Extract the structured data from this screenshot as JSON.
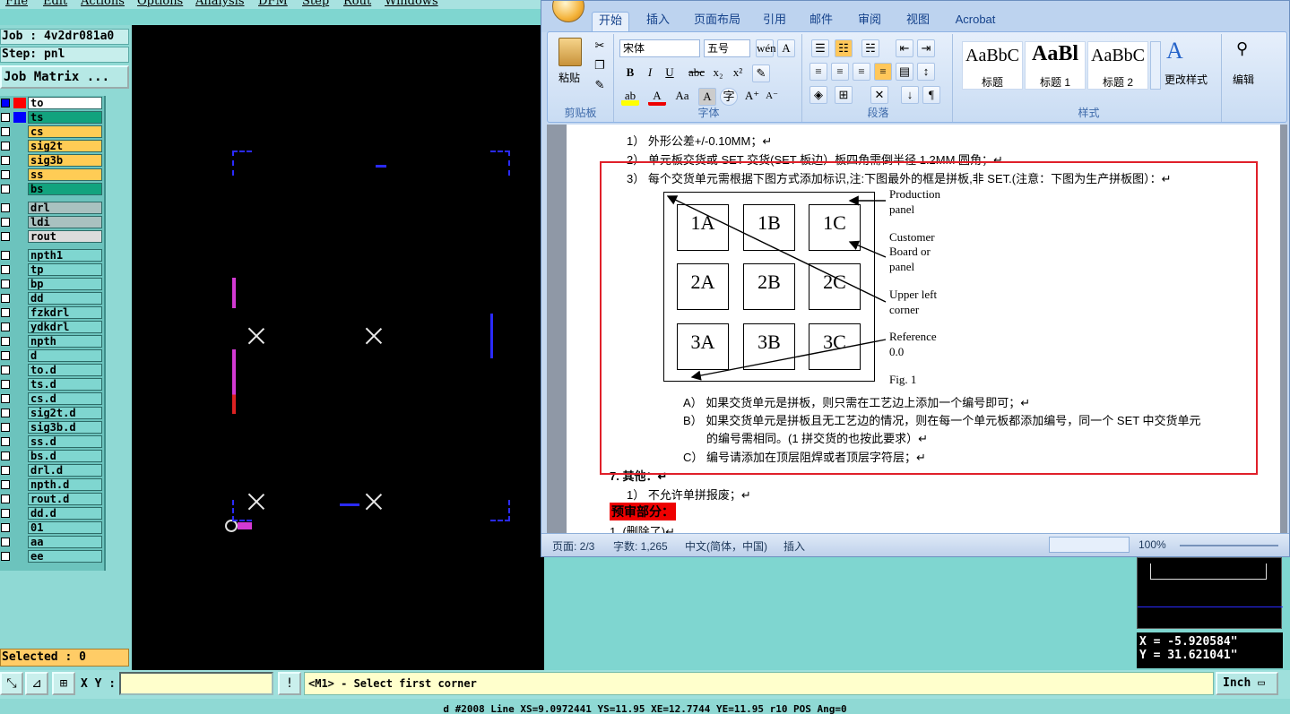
{
  "menu": [
    "File",
    "Edit",
    "Actions",
    "Options",
    "Analysis",
    "DFM",
    "Step",
    "Rout",
    "Windows"
  ],
  "job": {
    "label": "Job : 4v2dr081a0",
    "step": "Step: pnl",
    "matrix_button": "Job Matrix ..."
  },
  "layers": [
    {
      "name": "to",
      "color": "#ffffff",
      "sw": "#ff0000",
      "sel": "#0000ff"
    },
    {
      "name": "ts",
      "color": "#12a37e",
      "sw": "#0000ff"
    },
    {
      "name": "cs",
      "color": "#ffcc55"
    },
    {
      "name": "sig2t",
      "color": "#ffcc55"
    },
    {
      "name": "sig3b",
      "color": "#ffcc55"
    },
    {
      "name": "ss",
      "color": "#ffcc55"
    },
    {
      "name": "bs",
      "color": "#12a37e"
    },
    {
      "name": "drl",
      "color": "#a9c1c0"
    },
    {
      "name": "ldi",
      "color": "#a9c1c0"
    },
    {
      "name": "rout",
      "color": "#dcdcdc"
    },
    {
      "name": "npth1",
      "color": "#7fd6d0"
    },
    {
      "name": "tp",
      "color": "#7fd6d0"
    },
    {
      "name": "bp",
      "color": "#7fd6d0"
    },
    {
      "name": "dd",
      "color": "#7fd6d0"
    },
    {
      "name": "fzkdrl",
      "color": "#7fd6d0"
    },
    {
      "name": "ydkdrl",
      "color": "#7fd6d0"
    },
    {
      "name": "npth",
      "color": "#7fd6d0"
    },
    {
      "name": "d",
      "color": "#7fd6d0"
    },
    {
      "name": "to.d",
      "color": "#7fd6d0"
    },
    {
      "name": "ts.d",
      "color": "#7fd6d0"
    },
    {
      "name": "cs.d",
      "color": "#7fd6d0"
    },
    {
      "name": "sig2t.d",
      "color": "#7fd6d0"
    },
    {
      "name": "sig3b.d",
      "color": "#7fd6d0"
    },
    {
      "name": "ss.d",
      "color": "#7fd6d0"
    },
    {
      "name": "bs.d",
      "color": "#7fd6d0"
    },
    {
      "name": "drl.d",
      "color": "#7fd6d0"
    },
    {
      "name": "npth.d",
      "color": "#7fd6d0"
    },
    {
      "name": "rout.d",
      "color": "#7fd6d0"
    },
    {
      "name": "dd.d",
      "color": "#7fd6d0"
    },
    {
      "name": "01",
      "color": "#7fd6d0"
    },
    {
      "name": "aa",
      "color": "#7fd6d0"
    },
    {
      "name": "ee",
      "color": "#7fd6d0"
    }
  ],
  "selected": "Selected : 0",
  "word": {
    "tabs": [
      "开始",
      "插入",
      "页面布局",
      "引用",
      "邮件",
      "审阅",
      "视图",
      "Acrobat"
    ],
    "clipboard": {
      "paste": "粘贴",
      "group": "剪贴板"
    },
    "font": {
      "name": "宋体",
      "size": "五号",
      "group": "字体"
    },
    "paragraph": {
      "group": "段落"
    },
    "styles": {
      "items": [
        {
          "sample": "AaBbC",
          "name": "标题"
        },
        {
          "sample": "AaBl",
          "name": "标题 1"
        },
        {
          "sample": "AaBbC",
          "name": "标题 2"
        }
      ],
      "change": "更改样式",
      "group": "样式"
    },
    "edit": "编辑",
    "doc": {
      "l1": "1） 外形公差+/-0.10MM；↵",
      "l2": "2） 单元板交货或 SET 交货(SET 板边）板四角需倒半径 1.2MM 圆角；↵",
      "l3": "3） 每个交货单元需根据下图方式添加标识,注:下图最外的框是拼板,非 SET.(注意：下图为生产拼板图）：↵",
      "cells": [
        "1A",
        "1B",
        "1C",
        "2A",
        "2B",
        "2C",
        "3A",
        "3B",
        "3C"
      ],
      "fig_production": "Production",
      "fig_panel": "panel",
      "fig_customer": "Customer",
      "fig_board_or": "Board or",
      "fig_panel2": "panel",
      "fig_upper": "Upper left",
      "fig_corner": "corner",
      "fig_reference": "Reference",
      "fig_origin": "0.0",
      "fig_caption": "Fig. 1",
      "la": "A） 如果交货单元是拼板，则只需在工艺边上添加一个编号即可；↵",
      "lb1": "B） 如果交货单元是拼板且无工艺边的情况，则在每一个单元板都添加编号，同一个 SET 中交货单元",
      "lb2": "的编号需相同。(1 拼交货的也按此要求）↵",
      "lc": "C） 编号请添加在顶层阻焊或者顶层字符层；↵",
      "l7": "7. 其他：↵",
      "l71": "1） 不允许单拼报废；↵",
      "review": "预审部分：",
      "deleted": "1.  (删除了)↵"
    },
    "status": {
      "page": "页面: 2/3",
      "words": "字数: 1,265",
      "lang": "中文(简体，中国)",
      "mode": "插入",
      "zoom": "100%"
    }
  },
  "coords": {
    "x": "X = -5.920584\"",
    "y": "Y = 31.621041\""
  },
  "bottom": {
    "xy_label": "X Y :",
    "prompt": "<M1> - Select first corner",
    "unit": "Inch"
  },
  "footer": "d #2008 Line XS=9.0972441 YS=11.95 XE=12.7744 YE=11.95 r10 POS Ang=0"
}
